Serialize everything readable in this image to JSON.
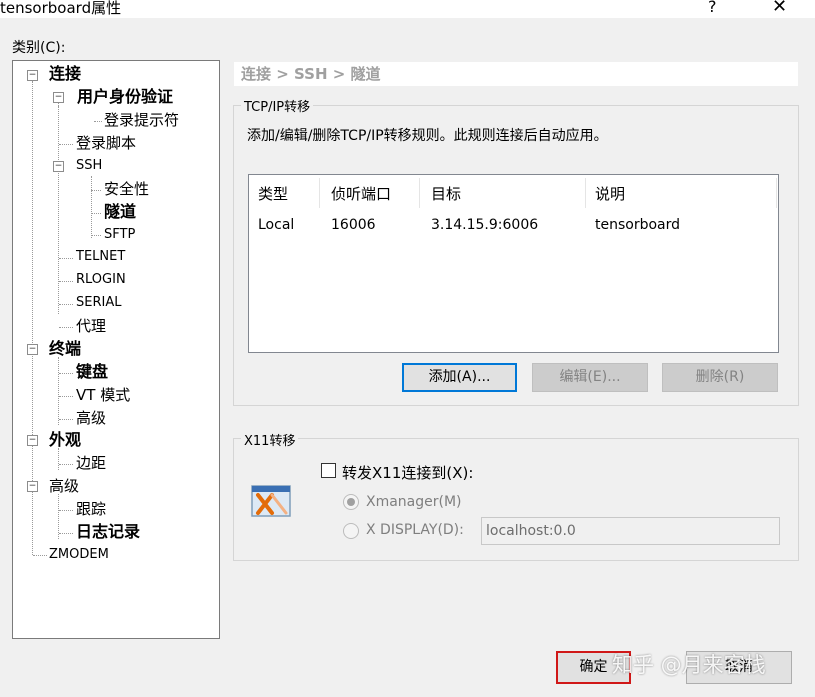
{
  "window": {
    "title": "tensorboard属性",
    "help": "?",
    "close": "✕"
  },
  "category": {
    "label": "类别(C):",
    "items": [
      {
        "label": "连接"
      },
      {
        "label": "用户身份验证"
      },
      {
        "label": "登录提示符"
      },
      {
        "label": "登录脚本"
      },
      {
        "label": "SSH"
      },
      {
        "label": "安全性"
      },
      {
        "label": "隧道"
      },
      {
        "label": "SFTP"
      },
      {
        "label": "TELNET"
      },
      {
        "label": "RLOGIN"
      },
      {
        "label": "SERIAL"
      },
      {
        "label": "代理"
      },
      {
        "label": "终端"
      },
      {
        "label": "键盘"
      },
      {
        "label": "VT 模式"
      },
      {
        "label": "高级"
      },
      {
        "label": "外观"
      },
      {
        "label": "边距"
      },
      {
        "label": "高级"
      },
      {
        "label": "跟踪"
      },
      {
        "label": "日志记录"
      },
      {
        "label": "ZMODEM"
      }
    ]
  },
  "breadcrumb": "连接 > SSH > 隧道",
  "tcp": {
    "group_title": "TCP/IP转移",
    "description": "添加/编辑/删除TCP/IP转移规则。此规则连接后自动应用。",
    "columns": [
      "类型",
      "侦听端口",
      "目标",
      "说明"
    ],
    "rows": [
      [
        "Local",
        "16006",
        "3.14.15.9:6006",
        "tensorboard"
      ]
    ],
    "add_button": "添加(A)...",
    "edit_button": "编辑(E)...",
    "delete_button": "删除(R)"
  },
  "x11": {
    "group_title": "X11转移",
    "forward_checkbox": "转发X11连接到(X):",
    "forward_checked": false,
    "xmanager_label": "Xmanager(M)",
    "xdisplay_label": "X DISPLAY(D):",
    "xdisplay_value": "localhost:0.0",
    "selected_option": "Xmanager(M)"
  },
  "footer": {
    "ok_button": "确定",
    "cancel_button": "取消"
  },
  "watermark": "知乎 @月来客栈",
  "colors": {
    "primary_border": "#0078d7",
    "highlight_border": "#d01818",
    "dialog_bg": "#f0f0f0"
  }
}
